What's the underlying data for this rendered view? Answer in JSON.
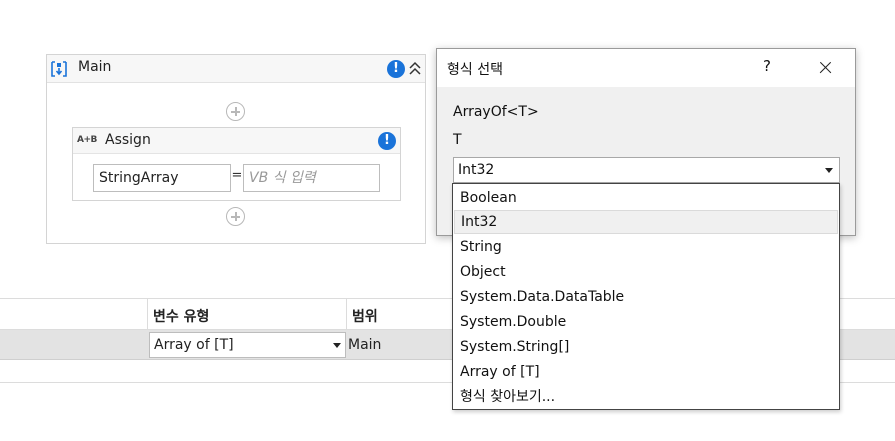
{
  "sequence": {
    "title": "Main",
    "assign": {
      "title": "Assign",
      "icon_text": "A+B",
      "to_value": "StringArray",
      "equals": "=",
      "value_placeholder": "VB 식 입력"
    }
  },
  "variables": {
    "columns": [
      "변수 유형",
      "범위"
    ],
    "row": {
      "type": "Array of [T]",
      "scope": "Main"
    }
  },
  "dialog": {
    "title": "형식 선택",
    "help": "?",
    "generic_name": "ArrayOf<T>",
    "param_label": "T",
    "selected": "Int32",
    "options": [
      "Boolean",
      "Int32",
      "String",
      "Object",
      "System.Data.DataTable",
      "System.Double",
      "System.String[]",
      "Array of [T]",
      "형식 찾아보기..."
    ]
  },
  "icons": {
    "sequence": "sequence-icon",
    "warning": "warning-icon",
    "collapse": "collapse-icon",
    "add": "add-activity-icon",
    "close": "close-icon"
  },
  "colors": {
    "warning": "#1a73d9",
    "row_highlight": "#e3e3e3",
    "selected_option": "#f0f0f0"
  }
}
